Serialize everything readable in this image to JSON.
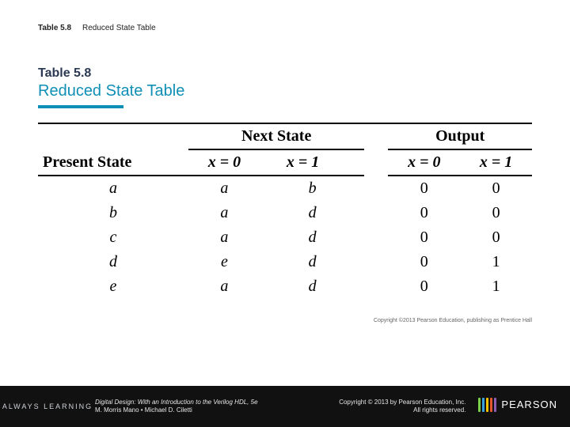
{
  "caption": {
    "label": "Table 5.8",
    "text": "Reduced State Table"
  },
  "figure": {
    "label": "Table 5.8",
    "title": "Reduced State Table",
    "headers": {
      "present_state": "Present State",
      "next_state": "Next State",
      "output": "Output",
      "x0": "x = 0",
      "x1": "x = 1"
    },
    "rows": [
      {
        "ps": "a",
        "ns0": "a",
        "ns1": "b",
        "o0": "0",
        "o1": "0"
      },
      {
        "ps": "b",
        "ns0": "a",
        "ns1": "d",
        "o0": "0",
        "o1": "0"
      },
      {
        "ps": "c",
        "ns0": "a",
        "ns1": "d",
        "o0": "0",
        "o1": "0"
      },
      {
        "ps": "d",
        "ns0": "e",
        "ns1": "d",
        "o0": "0",
        "o1": "1"
      },
      {
        "ps": "e",
        "ns0": "a",
        "ns1": "d",
        "o0": "0",
        "o1": "1"
      }
    ],
    "tiny_credit": "Copyright ©2013 Pearson Education, publishing as Prentice Hall"
  },
  "chart_data": {
    "type": "table",
    "title": "Reduced State Table",
    "columns": [
      "Present State",
      "Next State x=0",
      "Next State x=1",
      "Output x=0",
      "Output x=1"
    ],
    "rows": [
      [
        "a",
        "a",
        "b",
        0,
        0
      ],
      [
        "b",
        "a",
        "d",
        0,
        0
      ],
      [
        "c",
        "a",
        "d",
        0,
        0
      ],
      [
        "d",
        "e",
        "d",
        0,
        1
      ],
      [
        "e",
        "a",
        "d",
        0,
        1
      ]
    ]
  },
  "footer": {
    "always": "ALWAYS LEARNING",
    "book_title": "Digital Design: With an Introduction to the Verilog HDL, 5e",
    "authors": "M. Morris Mano • Michael D. Ciletti",
    "copyright": "Copyright © 2013 by Pearson Education, Inc.",
    "rights": "All rights reserved.",
    "brand": "PEARSON",
    "bar_colors": [
      "#7bd04a",
      "#3aa0e0",
      "#f2c200",
      "#e4572e",
      "#8e5fb4"
    ]
  }
}
